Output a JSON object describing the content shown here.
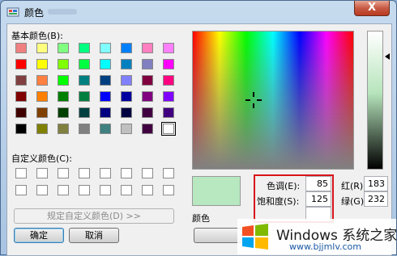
{
  "window": {
    "title": "颜色",
    "close_symbol": "X"
  },
  "labels": {
    "basic_colors": "基本颜色(B):",
    "custom_colors": "自定义颜色(C):",
    "color_solid": "颜色",
    "hue": "色调(E):",
    "sat": "饱和度(S):",
    "red": "红(R):",
    "green": "绿(G):"
  },
  "values": {
    "hue": "85",
    "sat": "125",
    "red": "183",
    "green": "232"
  },
  "buttons": {
    "define_custom": "规定自定义颜色(D) >>",
    "ok": "确定",
    "cancel": "取消"
  },
  "basic_colors": [
    "#f08080",
    "#ffff80",
    "#80ff80",
    "#00ff80",
    "#80ffff",
    "#0080ff",
    "#ff80c0",
    "#ff80ff",
    "#ff0000",
    "#ffff00",
    "#80ff00",
    "#00ff40",
    "#00ffff",
    "#0080c0",
    "#8080c0",
    "#ff00ff",
    "#804040",
    "#ff8040",
    "#00ff00",
    "#008080",
    "#004080",
    "#8080ff",
    "#800040",
    "#ff0080",
    "#800000",
    "#ff8000",
    "#008000",
    "#008040",
    "#0000ff",
    "#0000a0",
    "#800080",
    "#8000ff",
    "#400000",
    "#804000",
    "#004000",
    "#004040",
    "#000080",
    "#000040",
    "#400040",
    "#400080",
    "#000000",
    "#808000",
    "#808040",
    "#808080",
    "#408080",
    "#c0c0c0",
    "#400040",
    "#ffffff"
  ],
  "selected_basic_index": 47,
  "current_color": "#b7e8c0",
  "watermark": {
    "title": "Windows 系统之家",
    "url": "www.bjjmlv.com"
  }
}
